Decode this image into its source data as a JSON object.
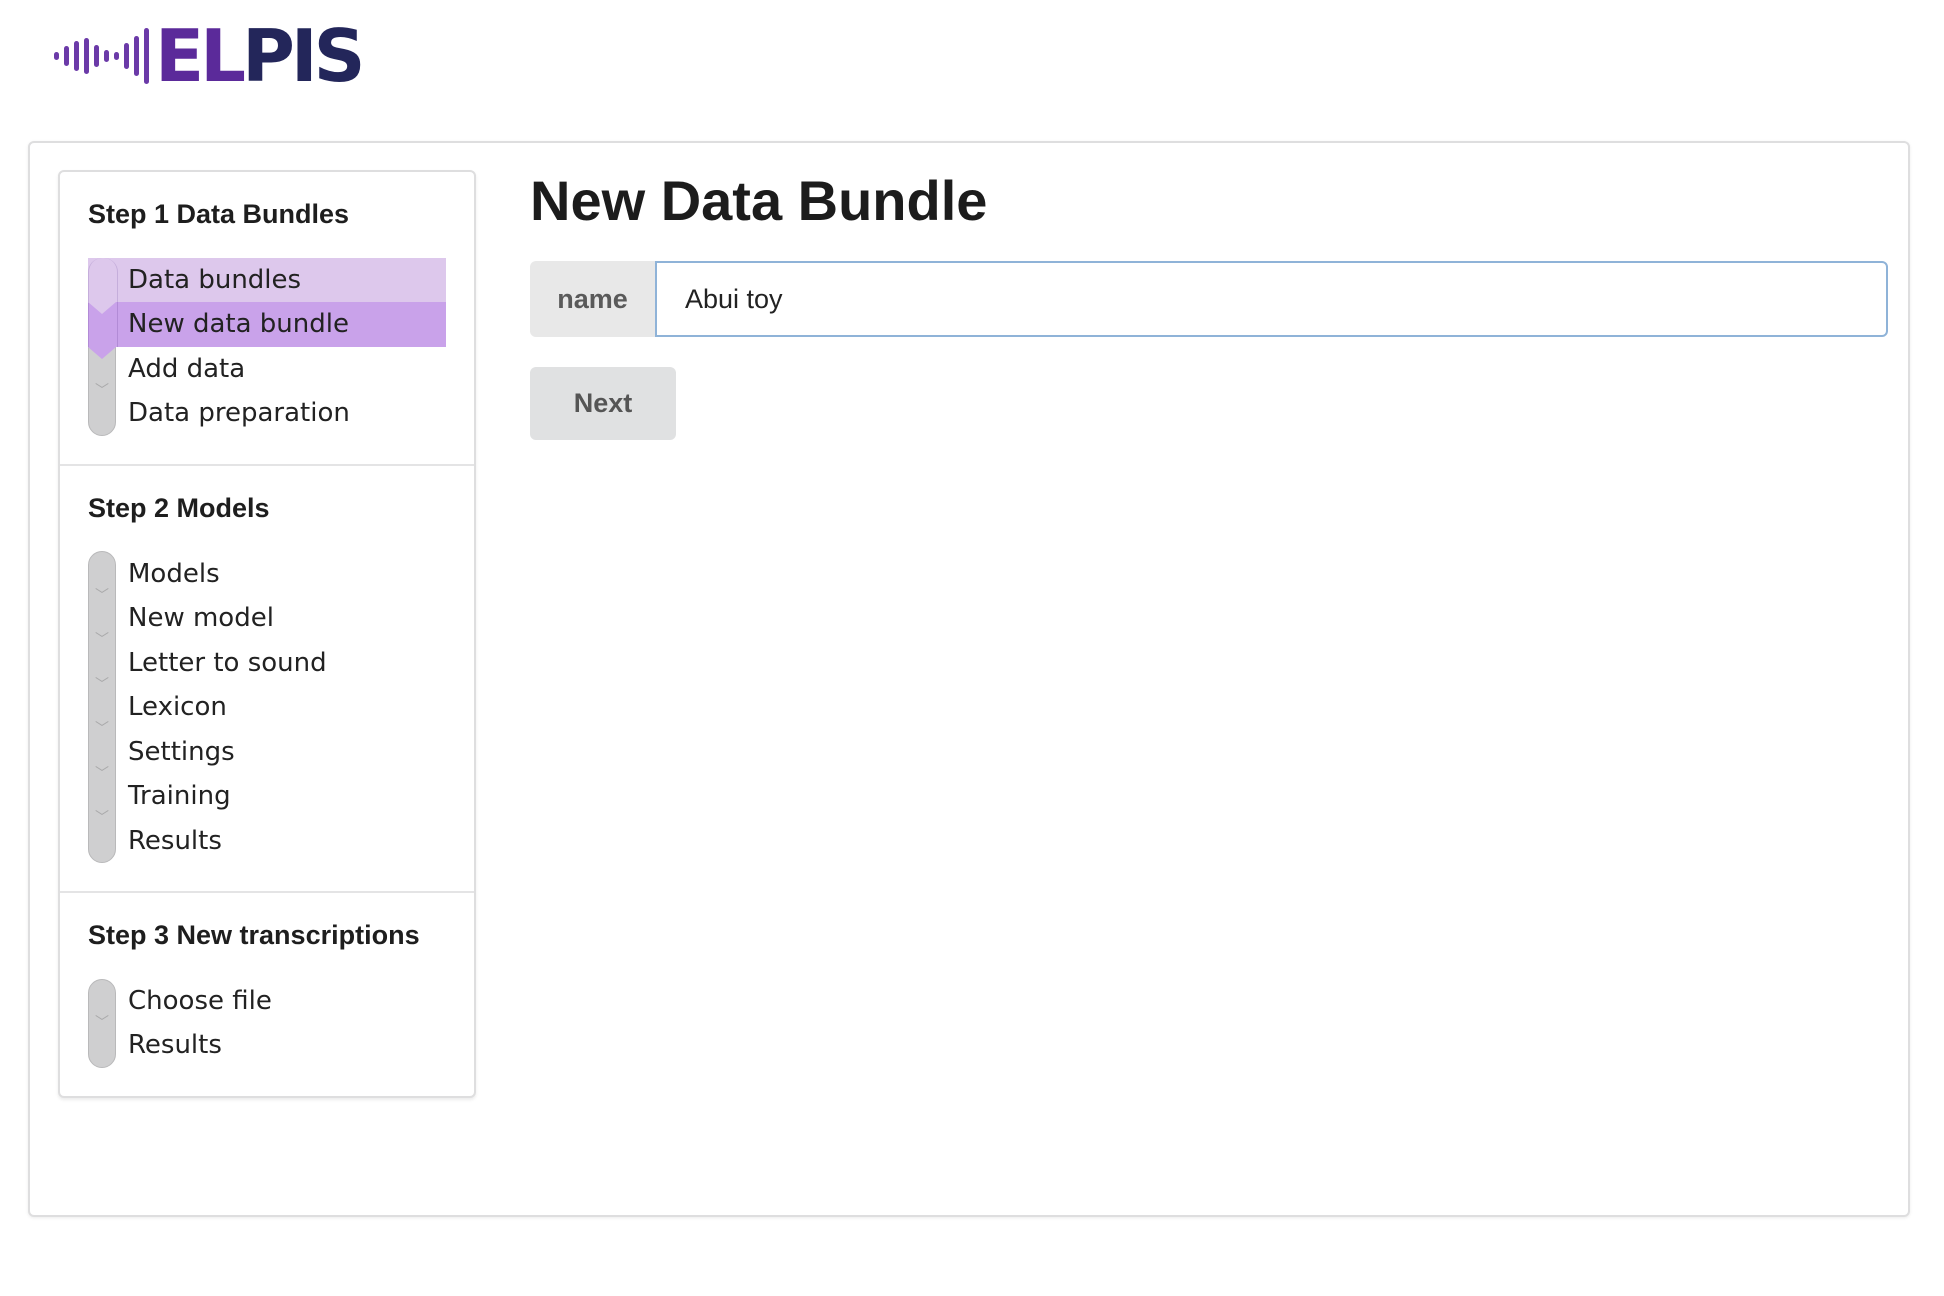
{
  "brand": {
    "logo_part1": "EL",
    "logo_part2": "PIS",
    "logo_icon": "sound-wave-icon",
    "colors": {
      "purple": "#5b2a9a",
      "navy": "#23265a"
    }
  },
  "stepper": {
    "steps": [
      {
        "title": "Step 1 Data Bundles",
        "items": [
          "Data bundles",
          "New data bundle",
          "Add data",
          "Data preparation"
        ]
      },
      {
        "title": "Step 2 Models",
        "items": [
          "Models",
          "New model",
          "Letter to sound",
          "Lexicon",
          "Settings",
          "Training",
          "Results"
        ]
      },
      {
        "title": "Step 3 New transcriptions",
        "items": [
          "Choose file",
          "Results"
        ]
      }
    ],
    "colors": {
      "done": "#ddc8ec",
      "active": "#c9a2ea",
      "pending": "#cfcfd0"
    }
  },
  "main": {
    "title": "New Data Bundle",
    "name_label": "name",
    "name_value": "Abui toy",
    "next_label": "Next"
  }
}
